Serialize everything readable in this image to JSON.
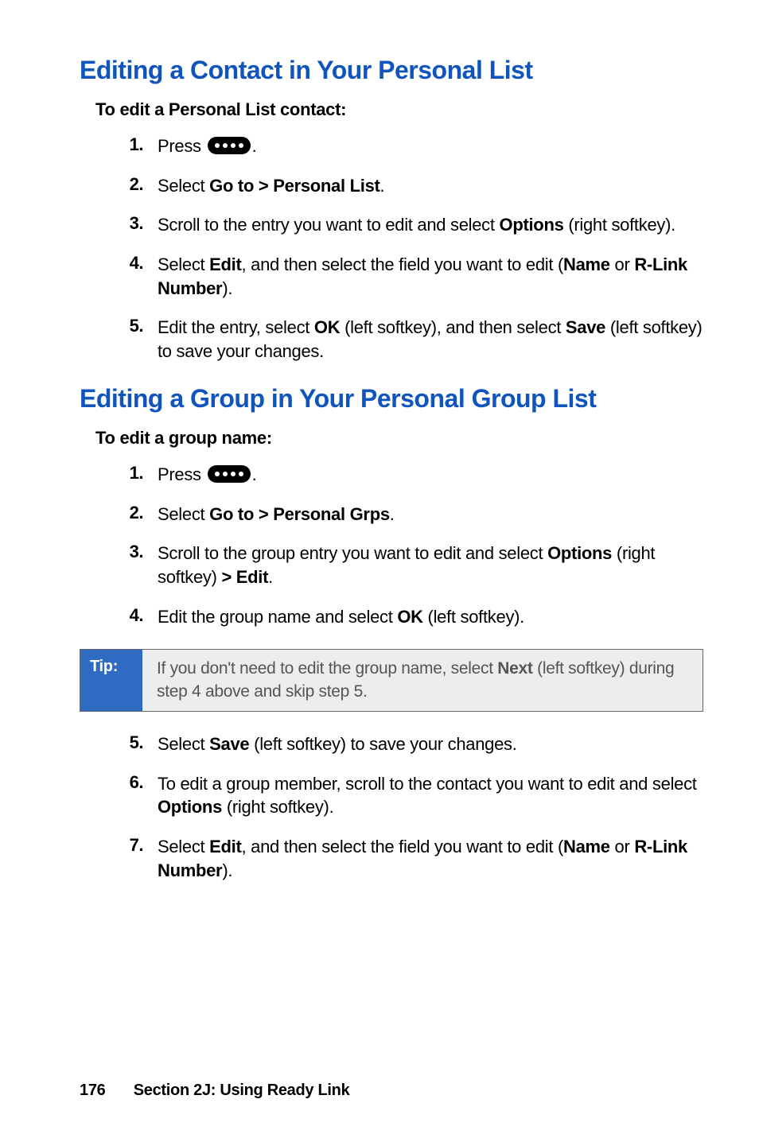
{
  "headings": {
    "h1": "Editing a Contact in Your Personal List",
    "sub1": "To edit a Personal List contact:",
    "h2": "Editing a Group in Your Personal Group List",
    "sub2": "To edit a group name:"
  },
  "steps_a": {
    "s1_pre": "Press ",
    "s1_post": ".",
    "s2_pre": "Select ",
    "s2_bold": "Go to > Personal List",
    "s2_post": ".",
    "s3_pre": "Scroll to the entry you want to edit and select ",
    "s3_bold": "Options",
    "s3_post": " (right softkey).",
    "s4_pre": "Select ",
    "s4_b1": "Edit",
    "s4_mid": ", and then select the field you want to edit (",
    "s4_b2": "Name",
    "s4_mid2": " or ",
    "s4_b3": "R-Link Number",
    "s4_post": ").",
    "s5_pre": "Edit the entry, select ",
    "s5_b1": "OK",
    "s5_mid": " (left softkey), and then select ",
    "s5_b2": "Save",
    "s5_post": " (left softkey) to save your changes."
  },
  "steps_b": {
    "s1_pre": "Press ",
    "s1_post": ".",
    "s2_pre": "Select ",
    "s2_bold": "Go to > Personal Grps",
    "s2_post": ".",
    "s3_pre": "Scroll to the group entry you want to edit and select ",
    "s3_b1": "Options",
    "s3_mid": " (right softkey) ",
    "s3_b2": "> Edit",
    "s3_post": ".",
    "s4_pre": "Edit the group name and select ",
    "s4_b1": "OK",
    "s4_post": " (left softkey).",
    "s5_pre": "Select ",
    "s5_b1": "Save",
    "s5_post": " (left softkey) to save your changes.",
    "s6_pre": "To edit a group member, scroll to the contact you want to edit and select ",
    "s6_b1": "Options",
    "s6_post": " (right softkey).",
    "s7_pre": "Select ",
    "s7_b1": "Edit",
    "s7_mid": ", and then select the field you want to edit (",
    "s7_b2": "Name",
    "s7_mid2": " or ",
    "s7_b3": "R-Link Number",
    "s7_post": ")."
  },
  "nums": {
    "n1": "1.",
    "n2": "2.",
    "n3": "3.",
    "n4": "4.",
    "n5": "5.",
    "n6": "6.",
    "n7": "7."
  },
  "tip": {
    "label": "Tip:",
    "pre": "If you don't need to edit the group name, select ",
    "bold": "Next",
    "post": " (left softkey) during step 4 above and skip step 5."
  },
  "footer": {
    "page": "176",
    "section": "Section 2J: Using Ready Link"
  }
}
